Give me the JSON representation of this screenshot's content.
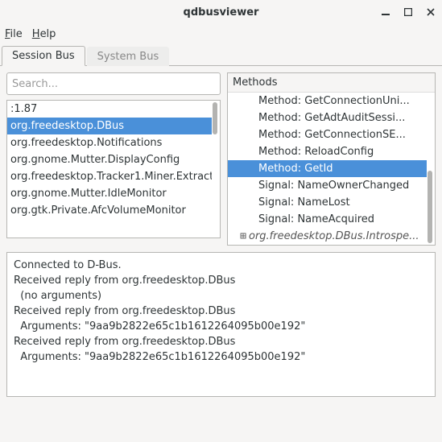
{
  "window": {
    "title": "qdbusviewer"
  },
  "menubar": {
    "file": "File",
    "help": "Help"
  },
  "tabs": {
    "session": "Session Bus",
    "system": "System Bus"
  },
  "search": {
    "placeholder": "Search..."
  },
  "services": [
    ":1.87",
    "org.freedesktop.DBus",
    "org.freedesktop.Notifications",
    "org.gnome.Mutter.DisplayConfig",
    "org.freedesktop.Tracker1.Miner.Extract",
    "org.gnome.Mutter.IdleMonitor",
    "org.gtk.Private.AfcVolumeMonitor"
  ],
  "services_selected_index": 1,
  "methods": {
    "header": "Methods",
    "items": [
      "Method: GetConnectionUni...",
      "Method: GetAdtAuditSessi...",
      "Method: GetConnectionSE...",
      "Method: ReloadConfig",
      "Method: GetId",
      "Signal: NameOwnerChanged",
      "Signal: NameLost",
      "Signal: NameAcquired"
    ],
    "selected_index": 4,
    "trailing": "org.freedesktop.DBus.Introspe..."
  },
  "log": [
    "Connected to D-Bus.",
    "",
    "Received reply from org.freedesktop.DBus",
    "  (no arguments)",
    "Received reply from org.freedesktop.DBus",
    "  Arguments: \"9aa9b2822e65c1b1612264095b00e192\"",
    "Received reply from org.freedesktop.DBus",
    "  Arguments: \"9aa9b2822e65c1b1612264095b00e192\""
  ]
}
